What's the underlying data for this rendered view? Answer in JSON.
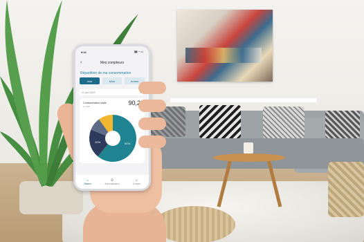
{
  "app": {
    "status_time": "9:41",
    "header_title": "Mes compteurs",
    "section_title": "Répartition de ma consommation",
    "tabs": [
      {
        "label": "Jour",
        "active": true
      },
      {
        "label": "Mois",
        "active": false
      },
      {
        "label": "Année",
        "active": false
      }
    ],
    "date": "22 juin 2023",
    "consumption": {
      "label": "Consommation totale",
      "sub": "en kWh",
      "value": "90,2"
    },
    "pie": {
      "segments": [
        {
          "value": 61,
          "label": "61%",
          "color": "#1f8391"
        },
        {
          "value": 20,
          "label": "20%",
          "color": "#2e3a5c"
        },
        {
          "value": 9,
          "label": "",
          "color": "#5e6b86"
        },
        {
          "value": 10,
          "label": "",
          "color": "#f2b72f"
        }
      ]
    },
    "nav": [
      {
        "label": "Maison",
        "icon": "home-icon",
        "active": true
      },
      {
        "label": "Automatisation",
        "icon": "automation-icon",
        "active": false
      },
      {
        "label": "Compte",
        "icon": "account-icon",
        "active": false
      }
    ]
  },
  "colors": {
    "accent": "#1c6b8a",
    "teal": "#1f8391",
    "navy": "#2e3a5c",
    "yellow": "#f2b72f"
  }
}
